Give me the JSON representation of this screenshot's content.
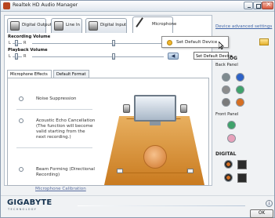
{
  "window": {
    "title": "Realtek HD Audio Manager"
  },
  "tabs": [
    {
      "label": "Digital Output"
    },
    {
      "label": "Line In"
    },
    {
      "label": "Digital Input"
    },
    {
      "label": "Microphone",
      "active": true
    }
  ],
  "volume": {
    "recording_label": "Recording Volume",
    "playback_label": "Playback Volume",
    "left": "L",
    "right": "R"
  },
  "dropdown": {
    "label": "Set Default Device"
  },
  "tooltip": {
    "label": "Set Default Device"
  },
  "subtabs": [
    {
      "label": "Microphone Effects",
      "active": true
    },
    {
      "label": "Default Format"
    }
  ],
  "options": [
    {
      "label": "Noise Suppression"
    },
    {
      "label": "Acoustic Echo Cancellation (The function will become valid starting from the next recording.)"
    },
    {
      "label": "Beam Forming (Directional Recording)"
    }
  ],
  "calibration": "Microphone Calibration",
  "right_panel": {
    "device_adv": "Device advanced settings",
    "analog": "ANALOG",
    "back_panel": "Back Panel",
    "front_panel": "Front Panel",
    "digital": "DIGITAL"
  },
  "footer": {
    "brand": "GIGABYTE",
    "brand_sub": "TECHNOLOGY",
    "ok": "OK",
    "info": "i"
  },
  "colors": {
    "jack_green": "#3fa36b",
    "jack_pink": "#e7a1ba",
    "jack_blue": "#2d62c7",
    "jack_gray": "#8c8c8c",
    "jack_black": "#2b2b2b",
    "jack_orange": "#d66f22"
  }
}
